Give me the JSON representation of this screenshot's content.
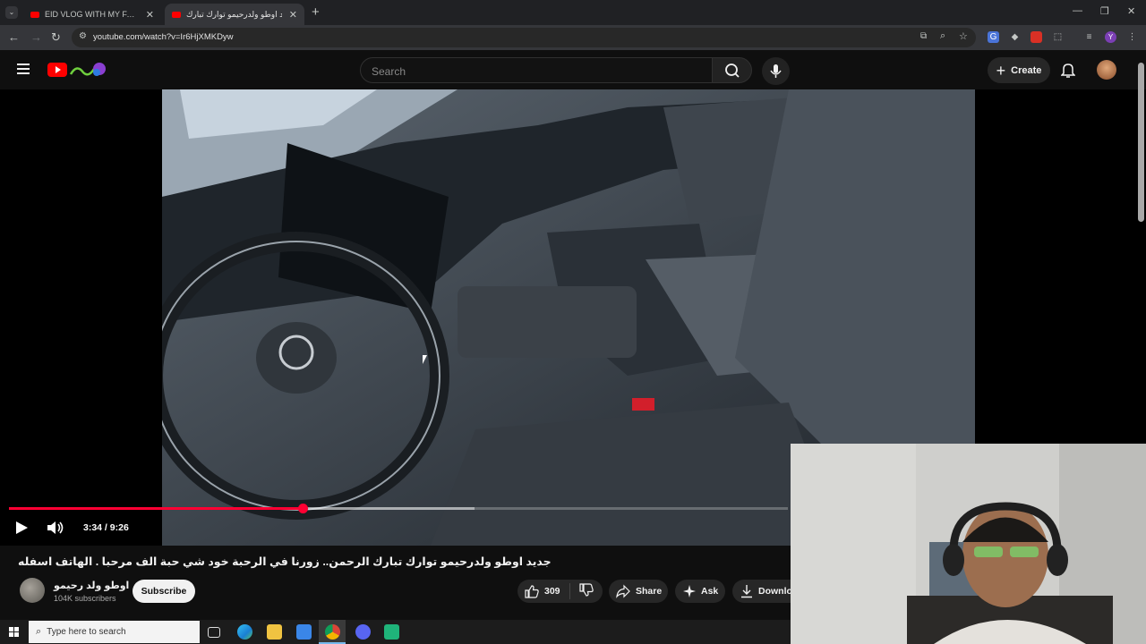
{
  "browser": {
    "tabs": [
      {
        "title": "EID VLOG WITH MY FAMILY I 😊",
        "active": false
      },
      {
        "title": "جديد اوطو ولدرحيمو توارك تبارك",
        "active": true
      }
    ],
    "url": "youtube.com/watch?v=Ir6HjXMKDyw",
    "new_tab": "+",
    "window_controls": {
      "minimize": "—",
      "restore": "❐",
      "close": "✕"
    },
    "profile_initial": "Y"
  },
  "youtube": {
    "search_placeholder": "Search",
    "create_label": "Create"
  },
  "player": {
    "current_time": "3:34",
    "duration": "9:26",
    "time_display": "3:34 / 9:26",
    "progress_fraction": 0.378,
    "buffered_fraction": 0.598
  },
  "video": {
    "title": "جديد اوطو ولدرحيمو توارك تبارك الرحمن.. زورنا في الرحبة خود شي حبة الف مرحبا . الهاتف اسفله",
    "channel_name": "اوطو ولد رحيمو",
    "subscribers": "104K subscribers",
    "subscribe_label": "Subscribe",
    "like_count": "309",
    "share_label": "Share",
    "ask_label": "Ask",
    "download_label": "Download"
  },
  "taskbar": {
    "search_placeholder": "Type here to search"
  },
  "colors": {
    "accent_red": "#ff0033",
    "bg": "#0f0f0f"
  }
}
